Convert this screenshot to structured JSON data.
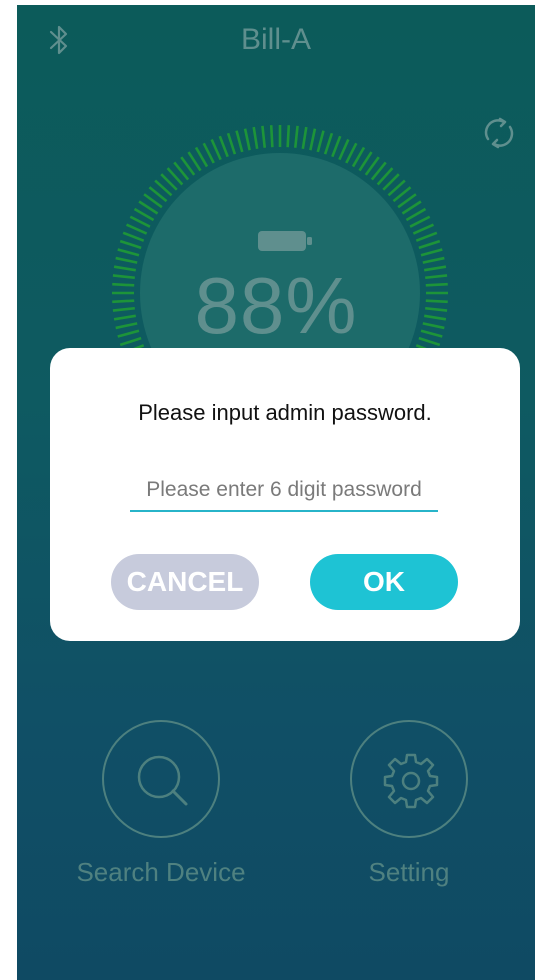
{
  "header": {
    "title": "Bill-A",
    "bluetooth_icon": "bluetooth-icon",
    "refresh_icon": "refresh-icon"
  },
  "battery": {
    "percent_text": "88%",
    "level": 0.88,
    "icon": "battery-icon",
    "gauge_color": "#1f9a35"
  },
  "dialog": {
    "message": "Please input admin password.",
    "password": {
      "placeholder": "Please enter 6 digit password",
      "value": ""
    },
    "cancel_label": "CANCEL",
    "ok_label": "OK",
    "accent_color": "#1ec3d4"
  },
  "actions": {
    "search_label": "Search Device",
    "search_icon": "search-icon",
    "setting_label": "Setting",
    "setting_icon": "gear-icon"
  }
}
